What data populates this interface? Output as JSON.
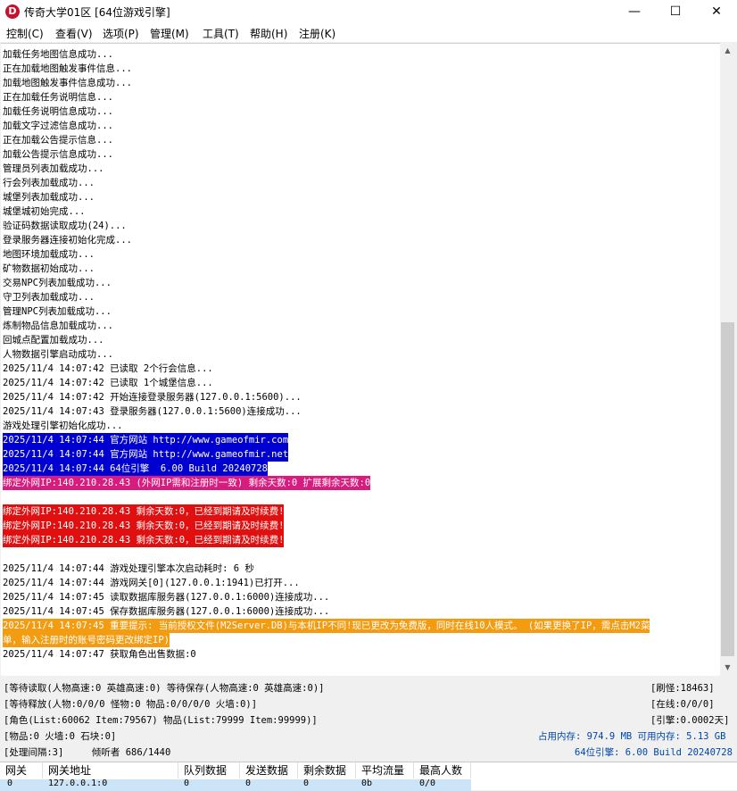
{
  "window": {
    "title": "传奇大学01区 [64位游戏引擎]",
    "app_icon_letter": "D",
    "minimize": "—",
    "maximize": "☐",
    "close": "✕"
  },
  "menu": [
    "控制(C)",
    "查看(V)",
    "选项(P)",
    "管理(M)",
    "工具(T)",
    "帮助(H)",
    "注册(K)"
  ],
  "colors": {
    "blue_bg": "#0000d0",
    "magenta_bg": "#d81b7e",
    "red_bg": "#e01010",
    "orange_bg": "#f39c12",
    "highlight_text": "#ffffff"
  },
  "log": [
    {
      "text": "加载任务地图信息成功..."
    },
    {
      "text": "正在加载地图触发事件信息..."
    },
    {
      "text": "加载地图触发事件信息成功..."
    },
    {
      "text": "正在加载任务说明信息..."
    },
    {
      "text": "加载任务说明信息成功..."
    },
    {
      "text": "加载文字过滤信息成功..."
    },
    {
      "text": "正在加载公告提示信息..."
    },
    {
      "text": "加载公告提示信息成功..."
    },
    {
      "text": "管理员列表加载成功..."
    },
    {
      "text": "行会列表加载成功..."
    },
    {
      "text": "城堡列表加载成功..."
    },
    {
      "text": "城堡城初始完成..."
    },
    {
      "text": "验证码数据读取成功(24)..."
    },
    {
      "text": "登录服务器连接初始化完成..."
    },
    {
      "text": "地图环境加载成功..."
    },
    {
      "text": "矿物数据初始成功..."
    },
    {
      "text": "交易NPC列表加载成功..."
    },
    {
      "text": "守卫列表加载成功..."
    },
    {
      "text": "管理NPC列表加载成功..."
    },
    {
      "text": "炼制物品信息加载成功..."
    },
    {
      "text": "回城点配置加载成功..."
    },
    {
      "text": "人物数据引擎启动成功..."
    },
    {
      "text": "2025/11/4 14:07:42 已读取 2个行会信息..."
    },
    {
      "text": "2025/11/4 14:07:42 已读取 1个城堡信息..."
    },
    {
      "text": "2025/11/4 14:07:42 开始连接登录服务器(127.0.0.1:5600)..."
    },
    {
      "text": "2025/11/4 14:07:43 登录服务器(127.0.0.1:5600)连接成功..."
    },
    {
      "text": "游戏处理引擎初始化成功..."
    },
    {
      "text": "2025/11/4 14:07:44 官方网站 http://www.gameofmir.com",
      "hl": "blue"
    },
    {
      "text": "2025/11/4 14:07:44 官方网站 http://www.gameofmir.net",
      "hl": "blue"
    },
    {
      "text": "2025/11/4 14:07:44 64位引擎  6.00 Build 20240728",
      "hl": "blue"
    },
    {
      "text": "绑定外网IP:140.210.28.43 (外网IP需和注册时一致) 剩余天数:0 扩展剩余天数:0",
      "hl": "magenta"
    },
    {
      "text": ""
    },
    {
      "text": "绑定外网IP:140.210.28.43 剩余天数:0，已经到期请及时续费!",
      "hl": "red"
    },
    {
      "text": "绑定外网IP:140.210.28.43 剩余天数:0，已经到期请及时续费!",
      "hl": "red"
    },
    {
      "text": "绑定外网IP:140.210.28.43 剩余天数:0，已经到期请及时续费!",
      "hl": "red"
    },
    {
      "text": ""
    },
    {
      "text": "2025/11/4 14:07:44 游戏处理引擎本次启动耗时: 6 秒"
    },
    {
      "text": "2025/11/4 14:07:44 游戏网关[0](127.0.0.1:1941)已打开..."
    },
    {
      "text": "2025/11/4 14:07:45 读取数据库服务器(127.0.0.1:6000)连接成功..."
    },
    {
      "text": "2025/11/4 14:07:45 保存数据库服务器(127.0.0.1:6000)连接成功..."
    },
    {
      "text": "2025/11/4 14:07:45 重要提示: 当前授权文件(M2Server.DB)与本机IP不同!现已更改为免费版，同时在线10人模式。 (如果更换了IP，需点击M2菜",
      "hl": "orange"
    },
    {
      "text": "单，输入注册时的账号密码更改绑定IP)",
      "hl": "orange"
    },
    {
      "text": "2025/11/4 14:07:47 获取角色出售数据:0"
    }
  ],
  "status": {
    "l1": "[等待读取(人物高速:0 英雄高速:0) 等待保存(人物高速:0 英雄高速:0)]",
    "r1": "[刷怪:18463]",
    "l2": "[等待释放(人物:0/0/0 怪物:0 物品:0/0/0/0 火墙:0)]",
    "r2": "[在线:0/0/0]",
    "l3": "[角色(List:60062 Item:79567) 物品(List:79999 Item:99999)]",
    "r3": "[引擎:0.0002天]",
    "l4": "[物品:0 火墙:0 石块:0]",
    "r4": "占用内存: 974.9 MB 可用内存: 5.13 GB",
    "l5": "[处理间隔:3]     倾听者 686/1440",
    "r5": "64位引擎: 6.00 Build 20240728"
  },
  "gateway_table": {
    "headers": [
      "网关",
      "网关地址",
      "队列数据",
      "发送数据",
      "剩余数据",
      "平均流量",
      "最高人数"
    ],
    "row": [
      "0",
      "127.0.0.1:0",
      "0",
      "0",
      "0",
      "0b",
      "0/0"
    ]
  }
}
